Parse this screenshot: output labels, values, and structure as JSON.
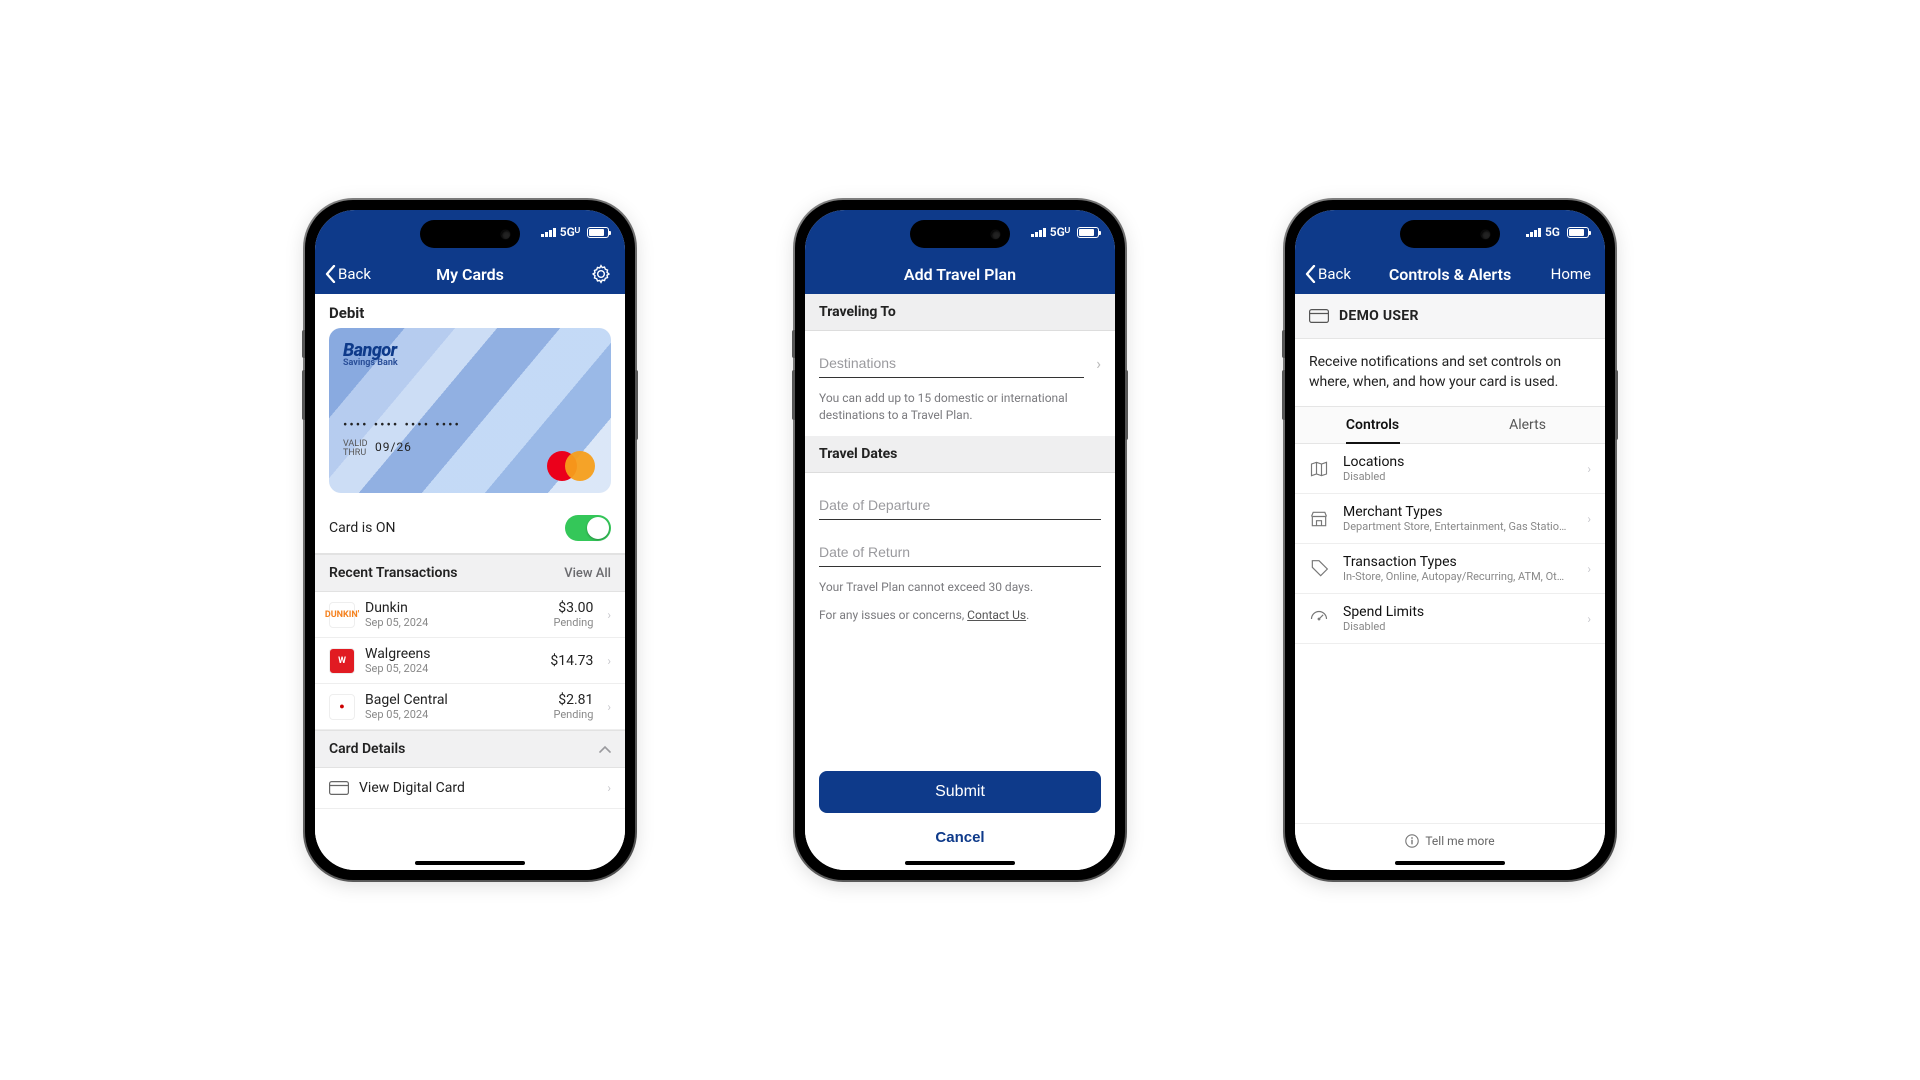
{
  "status": {
    "net1": "5G",
    "net1x": "5Gᵁ",
    "net_label_p1": "5Gᵁ",
    "net_label_p2": "5Gᵁ",
    "net_label_p3": "5G"
  },
  "p1": {
    "back": "Back",
    "title": "My Cards",
    "card_type": "Debit",
    "bank_name": "Bangor",
    "bank_sub": "Savings Bank",
    "masked": "••••  ••••  ••••  ••••",
    "valid_label": "VALID\nTHRU",
    "expiry": "09/26",
    "card_status": "Card is ON",
    "recent_header": "Recent Transactions",
    "view_all": "View All",
    "card_details": "Card Details",
    "view_digital": "View Digital Card",
    "tx": [
      {
        "name": "Dunkin",
        "date": "Sep 05, 2024",
        "amount": "$3.00",
        "status": "Pending",
        "icon": "DUNKIN'",
        "icon_bg": "#fff",
        "icon_fg": "#f5821f"
      },
      {
        "name": "Walgreens",
        "date": "Sep 05, 2024",
        "amount": "$14.73",
        "status": "",
        "icon": "W",
        "icon_bg": "#e11b22",
        "icon_fg": "#fff"
      },
      {
        "name": "Bagel Central",
        "date": "Sep 05, 2024",
        "amount": "$2.81",
        "status": "Pending",
        "icon": "●",
        "icon_bg": "#fff",
        "icon_fg": "#c00"
      }
    ]
  },
  "p2": {
    "title": "Add Travel Plan",
    "section1": "Traveling To",
    "destinations_ph": "Destinations",
    "dest_helper": "You can add up to 15 domestic or international destinations to a Travel Plan.",
    "section2": "Travel Dates",
    "dep_ph": "Date of Departure",
    "ret_ph": "Date of Return",
    "date_helper": "Your Travel Plan cannot exceed 30 days.",
    "issues_pre": "For any issues or concerns, ",
    "contact": "Contact Us",
    "submit": "Submit",
    "cancel": "Cancel"
  },
  "p3": {
    "back": "Back",
    "title": "Controls & Alerts",
    "home": "Home",
    "user": "DEMO USER",
    "desc": "Receive notifications and set controls on where, when, and how your card is used.",
    "tab_controls": "Controls",
    "tab_alerts": "Alerts",
    "tell_me": "Tell me more",
    "controls": [
      {
        "title": "Locations",
        "sub": "Disabled",
        "icon": "map"
      },
      {
        "title": "Merchant Types",
        "sub": "Department Store, Entertainment, Gas Station…",
        "icon": "store"
      },
      {
        "title": "Transaction Types",
        "sub": "In-Store, Online, Autopay/Recurring, ATM, Ot…",
        "icon": "tag"
      },
      {
        "title": "Spend Limits",
        "sub": "Disabled",
        "icon": "gauge"
      }
    ]
  }
}
